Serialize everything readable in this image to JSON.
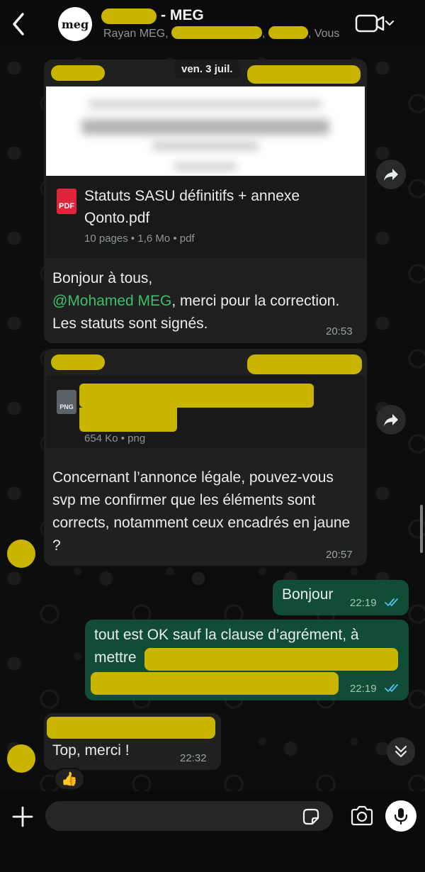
{
  "header": {
    "title_suffix": "- MEG",
    "avatar_text": "meg",
    "participants": [
      "Rayan MEG",
      "Vous"
    ]
  },
  "date_pill": "ven. 3 juil.",
  "messages": [
    {
      "document": {
        "title": "Statuts SASU définitifs + annexe Qonto.pdf",
        "icon_label": "PDF",
        "meta": "10 pages • 1,6 Mo • pdf"
      },
      "text_parts": [
        "Bonjour à tous,",
        "@Mohamed MEG",
        ", merci pour la correction. Les statuts sont signés."
      ],
      "time": "20:53"
    },
    {
      "document": {
        "icon_label": "PNG",
        "meta": "654 Ko • png"
      },
      "text": "Concernant l’annonce légale, pouvez-vous svp me confirmer que les éléments sont corrects, notamment ceux encadrés en jaune ?",
      "time": "20:57"
    },
    {
      "text": "Bonjour",
      "time": "22:19",
      "status": "read"
    },
    {
      "text": "tout est OK sauf la clause d’agrément, à mettre",
      "time": "22:19",
      "status": "read"
    },
    {
      "text": "Top, merci !",
      "time": "22:32",
      "reaction": "👍"
    }
  ],
  "input": {
    "placeholder": ""
  },
  "colors": {
    "outgoing_bubble": "#114d36",
    "incoming_bubble": "#202020",
    "mention": "#3fbe68",
    "redaction": "#c9b400",
    "read_ticks": "#53bdeb"
  },
  "icons": [
    "back-arrow-icon",
    "video-call-icon",
    "forward-icon",
    "pdf-file-icon",
    "png-file-icon",
    "read-ticks-icon",
    "scroll-down-icon",
    "plus-icon",
    "sticker-icon",
    "camera-icon",
    "microphone-icon"
  ]
}
